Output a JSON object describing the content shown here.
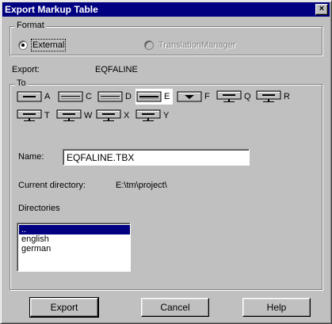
{
  "window": {
    "title": "Export Markup Table",
    "close_glyph": "×"
  },
  "format": {
    "group_label": "Format",
    "options": [
      {
        "label": "External",
        "checked": true,
        "disabled": false
      },
      {
        "label": "TranslationManager",
        "checked": false,
        "disabled": true
      }
    ]
  },
  "export": {
    "label": "Export:",
    "value": "EQFALINE"
  },
  "to": {
    "group_label": "To",
    "drives": [
      {
        "letter": "A",
        "icon": "floppy-drive-icon",
        "selected": false
      },
      {
        "letter": "C",
        "icon": "hard-drive-icon",
        "selected": false
      },
      {
        "letter": "D",
        "icon": "hard-drive-icon",
        "selected": false
      },
      {
        "letter": "E",
        "icon": "hard-drive-icon",
        "selected": true
      },
      {
        "letter": "F",
        "icon": "cdrom-drive-icon",
        "selected": false
      },
      {
        "letter": "Q",
        "icon": "network-drive-icon",
        "selected": false
      },
      {
        "letter": "R",
        "icon": "network-drive-icon",
        "selected": false
      },
      {
        "letter": "T",
        "icon": "network-drive-icon",
        "selected": false
      },
      {
        "letter": "W",
        "icon": "network-drive-icon",
        "selected": false
      },
      {
        "letter": "X",
        "icon": "network-drive-icon",
        "selected": false
      },
      {
        "letter": "Y",
        "icon": "network-drive-icon",
        "selected": false
      }
    ]
  },
  "name": {
    "label": "Name:",
    "value": "EQFALINE.TBX"
  },
  "current_directory": {
    "label": "Current directory:",
    "value": "E:\\tm\\project\\"
  },
  "directories": {
    "label": "Directories",
    "items": [
      {
        "name": "..",
        "selected": true
      },
      {
        "name": "english",
        "selected": false
      },
      {
        "name": "german",
        "selected": false
      }
    ]
  },
  "buttons": {
    "export": "Export",
    "cancel": "Cancel",
    "help": "Help"
  },
  "colors": {
    "titlebar": "#000080",
    "face": "#c0c0c0",
    "selection": "#000080"
  }
}
